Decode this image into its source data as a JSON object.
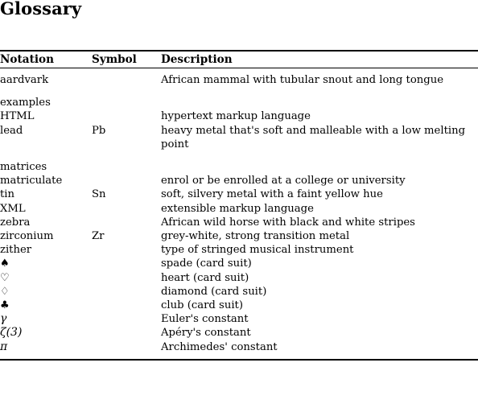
{
  "document": {
    "title": "Glossary"
  },
  "table": {
    "headers": {
      "notation": "Notation",
      "symbol": "Symbol",
      "description": "Description"
    },
    "rows": [
      {
        "notation": "aardvark",
        "symbol": "",
        "description": "African mammal with tubular snout and long tongue",
        "group_start": false
      },
      {
        "notation": "examples",
        "symbol": "",
        "description": "",
        "group_start": true
      },
      {
        "notation": "HTML",
        "symbol": "",
        "description": "hypertext markup language",
        "group_start": false
      },
      {
        "notation": "lead",
        "symbol": "Pb",
        "description": "heavy metal that's soft and malleable with a low melting point",
        "group_start": false
      },
      {
        "notation": "matrices",
        "symbol": "",
        "description": "",
        "group_start": true
      },
      {
        "notation": "matriculate",
        "symbol": "",
        "description": "enrol or be enrolled at a college or university",
        "group_start": false
      },
      {
        "notation": "tin",
        "symbol": "Sn",
        "description": "soft, silvery metal with a faint yellow hue",
        "group_start": false
      },
      {
        "notation": "XML",
        "symbol": "",
        "description": "extensible markup language",
        "group_start": false
      },
      {
        "notation": "zebra",
        "symbol": "",
        "description": "African wild horse with black and white stripes",
        "group_start": false
      },
      {
        "notation": "zirconium",
        "symbol": "Zr",
        "description": "grey-white, strong transition metal",
        "group_start": false
      },
      {
        "notation": "zither",
        "symbol": "",
        "description": "type of stringed musical instrument",
        "group_start": false
      },
      {
        "notation": "♠",
        "notation_kind": "suit",
        "symbol": "",
        "description": "spade (card suit)",
        "group_start": false
      },
      {
        "notation": "♡",
        "notation_kind": "suit",
        "symbol": "",
        "description": "heart (card suit)",
        "group_start": false
      },
      {
        "notation": "♢",
        "notation_kind": "suit",
        "symbol": "",
        "description": "diamond (card suit)",
        "group_start": false
      },
      {
        "notation": "♣",
        "notation_kind": "suit",
        "symbol": "",
        "description": "club (card suit)",
        "group_start": false
      },
      {
        "notation": "γ",
        "notation_kind": "math",
        "symbol": "",
        "description": "Euler's constant",
        "group_start": false
      },
      {
        "notation": "ζ(3)",
        "notation_kind": "math",
        "symbol": "",
        "description": "Apéry's constant",
        "group_start": false
      },
      {
        "notation": "π",
        "notation_kind": "math",
        "symbol": "",
        "description": "Archimedes' constant",
        "group_start": false
      }
    ]
  }
}
